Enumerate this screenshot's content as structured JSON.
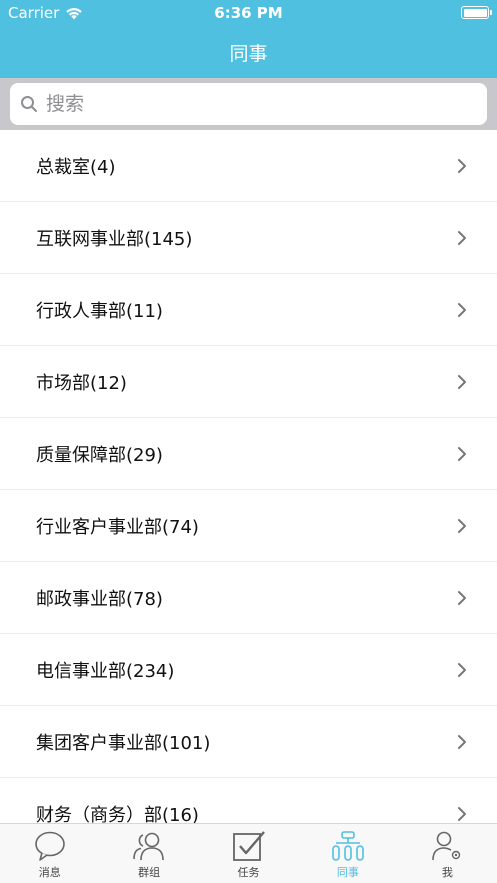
{
  "status": {
    "carrier": "Carrier",
    "time": "6:36 PM"
  },
  "nav": {
    "title": "同事"
  },
  "search": {
    "placeholder": "搜索"
  },
  "departments": [
    {
      "label": "总裁室(4)"
    },
    {
      "label": "互联网事业部(145)"
    },
    {
      "label": "行政人事部(11)"
    },
    {
      "label": "市场部(12)"
    },
    {
      "label": "质量保障部(29)"
    },
    {
      "label": "行业客户事业部(74)"
    },
    {
      "label": "邮政事业部(78)"
    },
    {
      "label": "电信事业部(234)"
    },
    {
      "label": "集团客户事业部(101)"
    },
    {
      "label": "财务（商务）部(16)"
    }
  ],
  "tabs": [
    {
      "label": "消息",
      "icon": "message-icon"
    },
    {
      "label": "群组",
      "icon": "group-icon"
    },
    {
      "label": "任务",
      "icon": "task-icon"
    },
    {
      "label": "同事",
      "icon": "colleague-icon",
      "active": true
    },
    {
      "label": "我",
      "icon": "profile-icon"
    }
  ],
  "colors": {
    "accent": "#4fc0df"
  }
}
